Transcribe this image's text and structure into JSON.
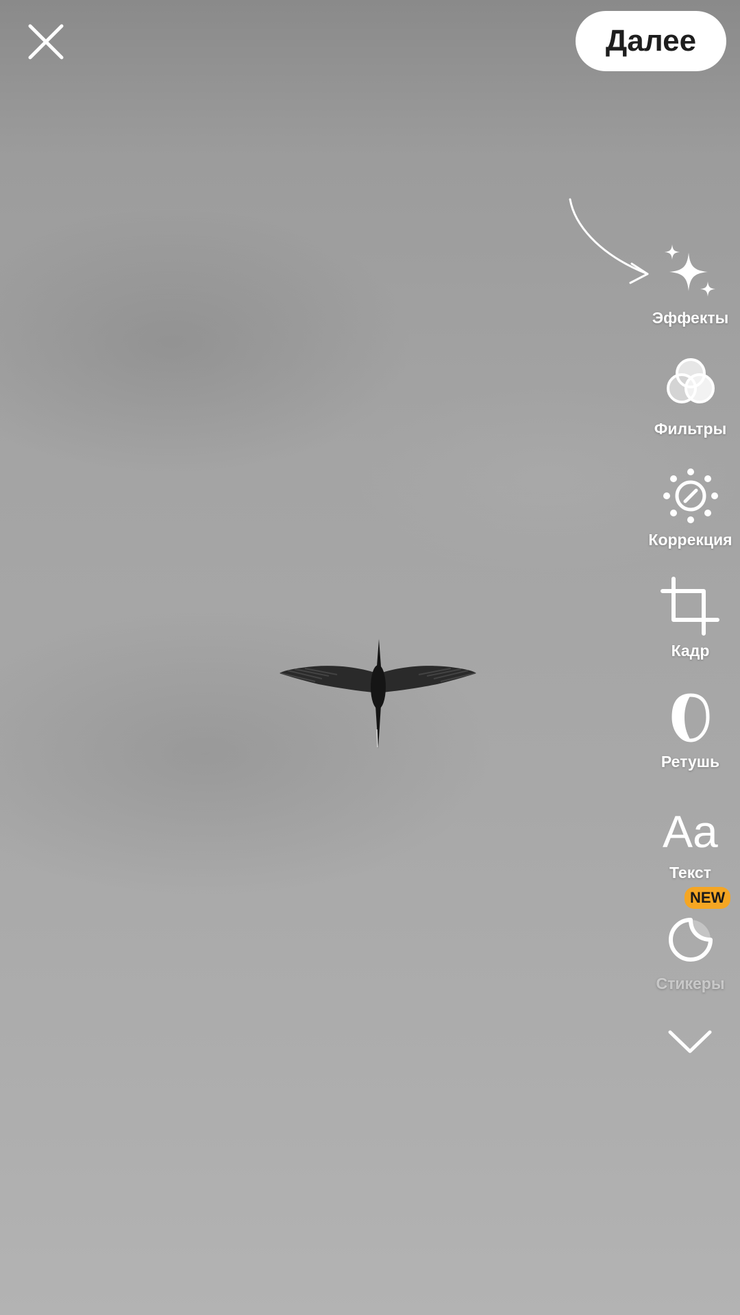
{
  "header": {
    "close_icon": "close-icon",
    "next_label": "Далее"
  },
  "tools": [
    {
      "label": "Эффекты",
      "icon": "sparkles-icon"
    },
    {
      "label": "Фильтры",
      "icon": "filters-icon"
    },
    {
      "label": "Коррекция",
      "icon": "adjust-icon"
    },
    {
      "label": "Кадр",
      "icon": "crop-icon"
    },
    {
      "label": "Ретушь",
      "icon": "retouch-icon"
    },
    {
      "label": "Текст",
      "icon": "text-icon"
    },
    {
      "label": "Стикеры",
      "icon": "sticker-icon",
      "badge": "NEW"
    }
  ],
  "more_icon": "chevron-down-icon",
  "colors": {
    "button_bg": "#ffffff",
    "button_text": "#1e1e1e",
    "badge_bg": "#f5a623",
    "icon": "#ffffff"
  }
}
